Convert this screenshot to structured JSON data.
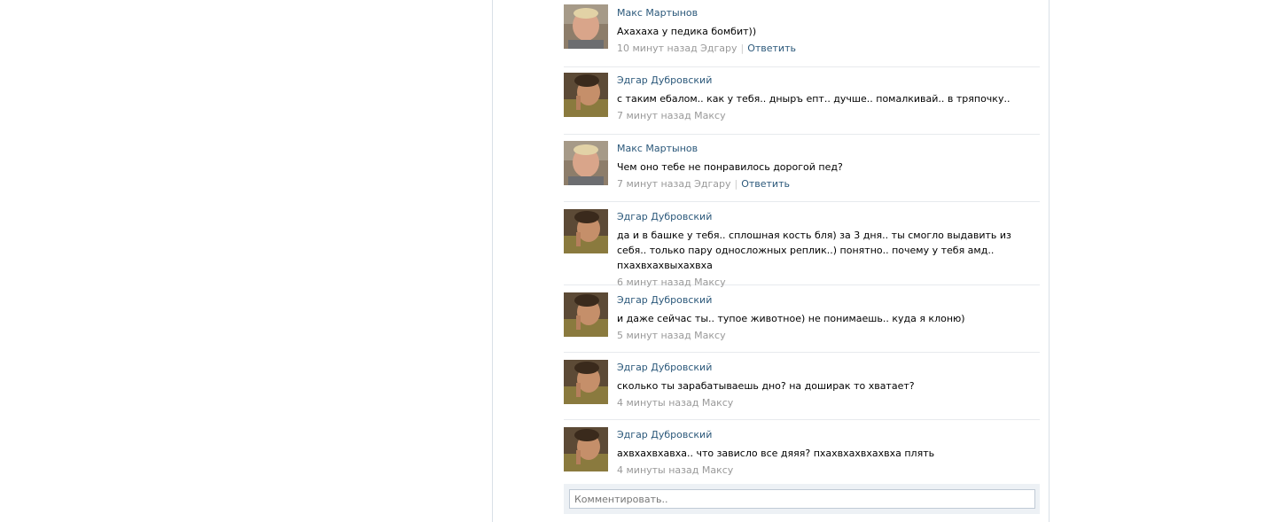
{
  "comments": [
    {
      "author": "Макс Мартынов",
      "avatar": "avatar-maks",
      "text": "Ахахаха у педика бомбит))",
      "meta": "10 минут назад Эдгару",
      "reply": "Ответить"
    },
    {
      "author": "Эдгар Дубровский",
      "avatar": "avatar-edgar",
      "text": "с таким ебалом.. как у тебя.. дныръ епт.. дучше.. помалкивай.. в тряпочку..",
      "meta": "7 минут назад Максу"
    },
    {
      "author": "Макс Мартынов",
      "avatar": "avatar-maks",
      "text": "Чем оно тебе не понравилось дорогой пед?",
      "meta": "7 минут назад Эдгару",
      "reply": "Ответить"
    },
    {
      "author": "Эдгар Дубровский",
      "avatar": "avatar-edgar",
      "text": "да и в башке у тебя.. сплошная кость бля) за 3 дня.. ты смогло выдавить из себя.. только пару односложных реплик..) понятно.. почему у тебя амд.. пхахвхахвыхахвха",
      "meta": "6 минут назад Максу"
    },
    {
      "author": "Эдгар Дубровский",
      "avatar": "avatar-edgar",
      "text": "и даже сейчас ты.. тупое животное) не понимаешь.. куда я клоню)",
      "meta": "5 минут назад Максу"
    },
    {
      "author": "Эдгар Дубровский",
      "avatar": "avatar-edgar",
      "text": "сколько ты зарабатываешь дно? на доширак то хватает?",
      "meta": "4 минуты назад Максу"
    },
    {
      "author": "Эдгар Дубровский",
      "avatar": "avatar-edgar",
      "text": "ахвхахвхавха.. что зависло все дяяя? пхахвхахвхахвха плять",
      "meta": "4 минуты назад Максу"
    }
  ],
  "composer": {
    "placeholder": "Комментировать.."
  },
  "colors": {
    "link": "#2b587a",
    "meta": "#999999",
    "composer_bg": "#edf1f5"
  }
}
